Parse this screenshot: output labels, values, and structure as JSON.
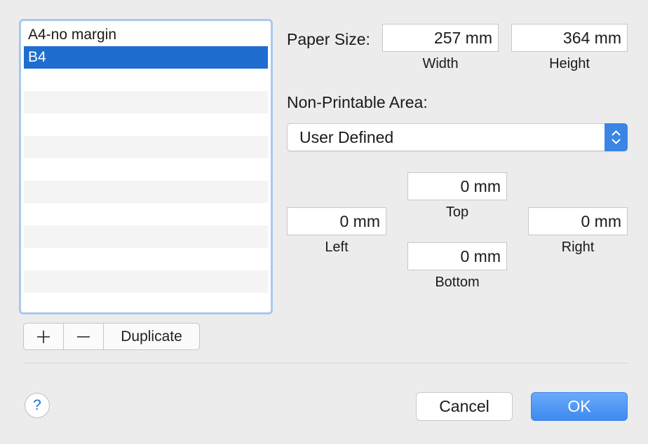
{
  "paper_list": {
    "items": [
      {
        "label": "A4-no margin",
        "selected": false
      },
      {
        "label": "B4",
        "selected": true
      }
    ]
  },
  "list_buttons": {
    "add_label": "+",
    "remove_label": "−",
    "duplicate_label": "Duplicate"
  },
  "paper_size": {
    "label": "Paper Size:",
    "width_value": "257 mm",
    "height_value": "364 mm",
    "width_caption": "Width",
    "height_caption": "Height"
  },
  "non_printable": {
    "label": "Non-Printable Area:",
    "selected_option": "User Defined"
  },
  "margins": {
    "top_value": "0 mm",
    "top_caption": "Top",
    "left_value": "0 mm",
    "left_caption": "Left",
    "right_value": "0 mm",
    "right_caption": "Right",
    "bottom_value": "0 mm",
    "bottom_caption": "Bottom"
  },
  "footer": {
    "help_label": "?",
    "cancel_label": "Cancel",
    "ok_label": "OK"
  },
  "colors": {
    "accent": "#1f6ecf",
    "ok_button": "#3e89f1",
    "list_focus_ring": "#a9c8ef"
  }
}
